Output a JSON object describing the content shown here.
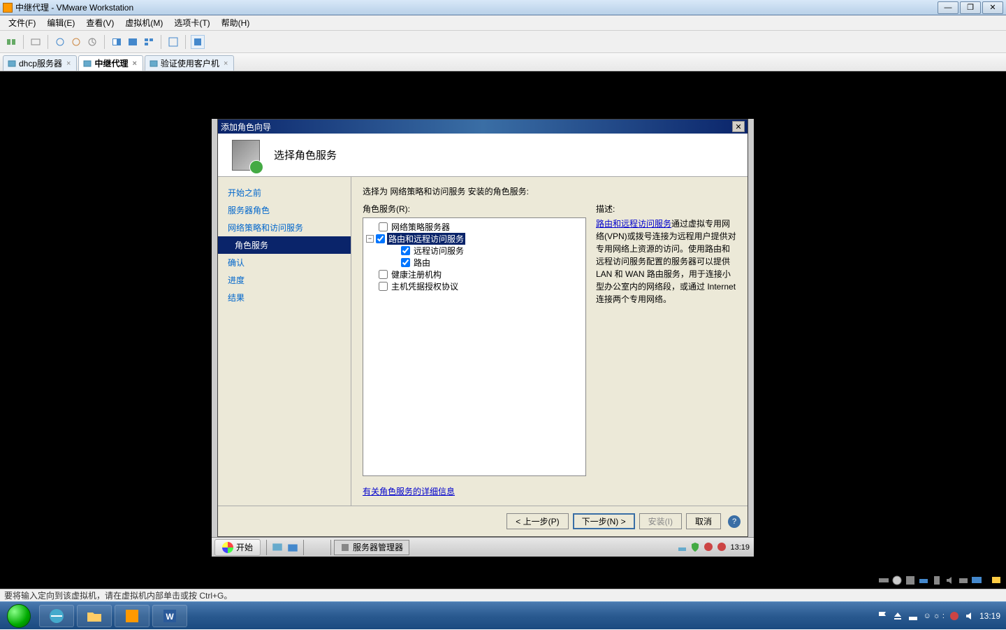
{
  "window": {
    "title": "中继代理 - VMware Workstation"
  },
  "menu": {
    "file": "文件(F)",
    "edit": "编辑(E)",
    "view": "查看(V)",
    "vm": "虚拟机(M)",
    "tabs": "选项卡(T)",
    "help": "帮助(H)"
  },
  "tabs": [
    {
      "label": "dhcp服务器",
      "active": false
    },
    {
      "label": "中继代理",
      "active": true
    },
    {
      "label": "验证使用客户机",
      "active": false
    }
  ],
  "dialog": {
    "title": "添加角色向导",
    "header": "选择角色服务",
    "nav": {
      "before": "开始之前",
      "roles": "服务器角色",
      "nps": "网络策略和访问服务",
      "rolesvc": "角色服务",
      "confirm": "确认",
      "progress": "进度",
      "results": "结果"
    },
    "content": {
      "prompt": "选择为 网络策略和访问服务 安装的角色服务:",
      "label": "角色服务(R):",
      "tree": {
        "nps_server": "网络策略服务器",
        "rras": "路由和远程访问服务",
        "remote_access": "远程访问服务",
        "routing": "路由",
        "health": "健康注册机构",
        "hcap": "主机凭据授权协议"
      },
      "desc_label": "描述:",
      "desc_link": "路由和远程访问服务",
      "desc_text": "通过虚拟专用网络(VPN)或拨号连接为远程用户提供对专用网络上资源的访问。使用路由和远程访问服务配置的服务器可以提供 LAN 和 WAN 路由服务，用于连接小型办公室内的网络段，或通过 Internet 连接两个专用网络。",
      "more_link": "有关角色服务的详细信息"
    },
    "footer": {
      "prev": "< 上一步(P)",
      "next": "下一步(N) >",
      "install": "安装(I)",
      "cancel": "取消"
    }
  },
  "guest_taskbar": {
    "start": "开始",
    "task": "服务器管理器",
    "clock": "13:19"
  },
  "statusbar": "要将输入定向到该虚拟机，请在虚拟机内部单击或按 Ctrl+G。",
  "host_clock": "13:19"
}
